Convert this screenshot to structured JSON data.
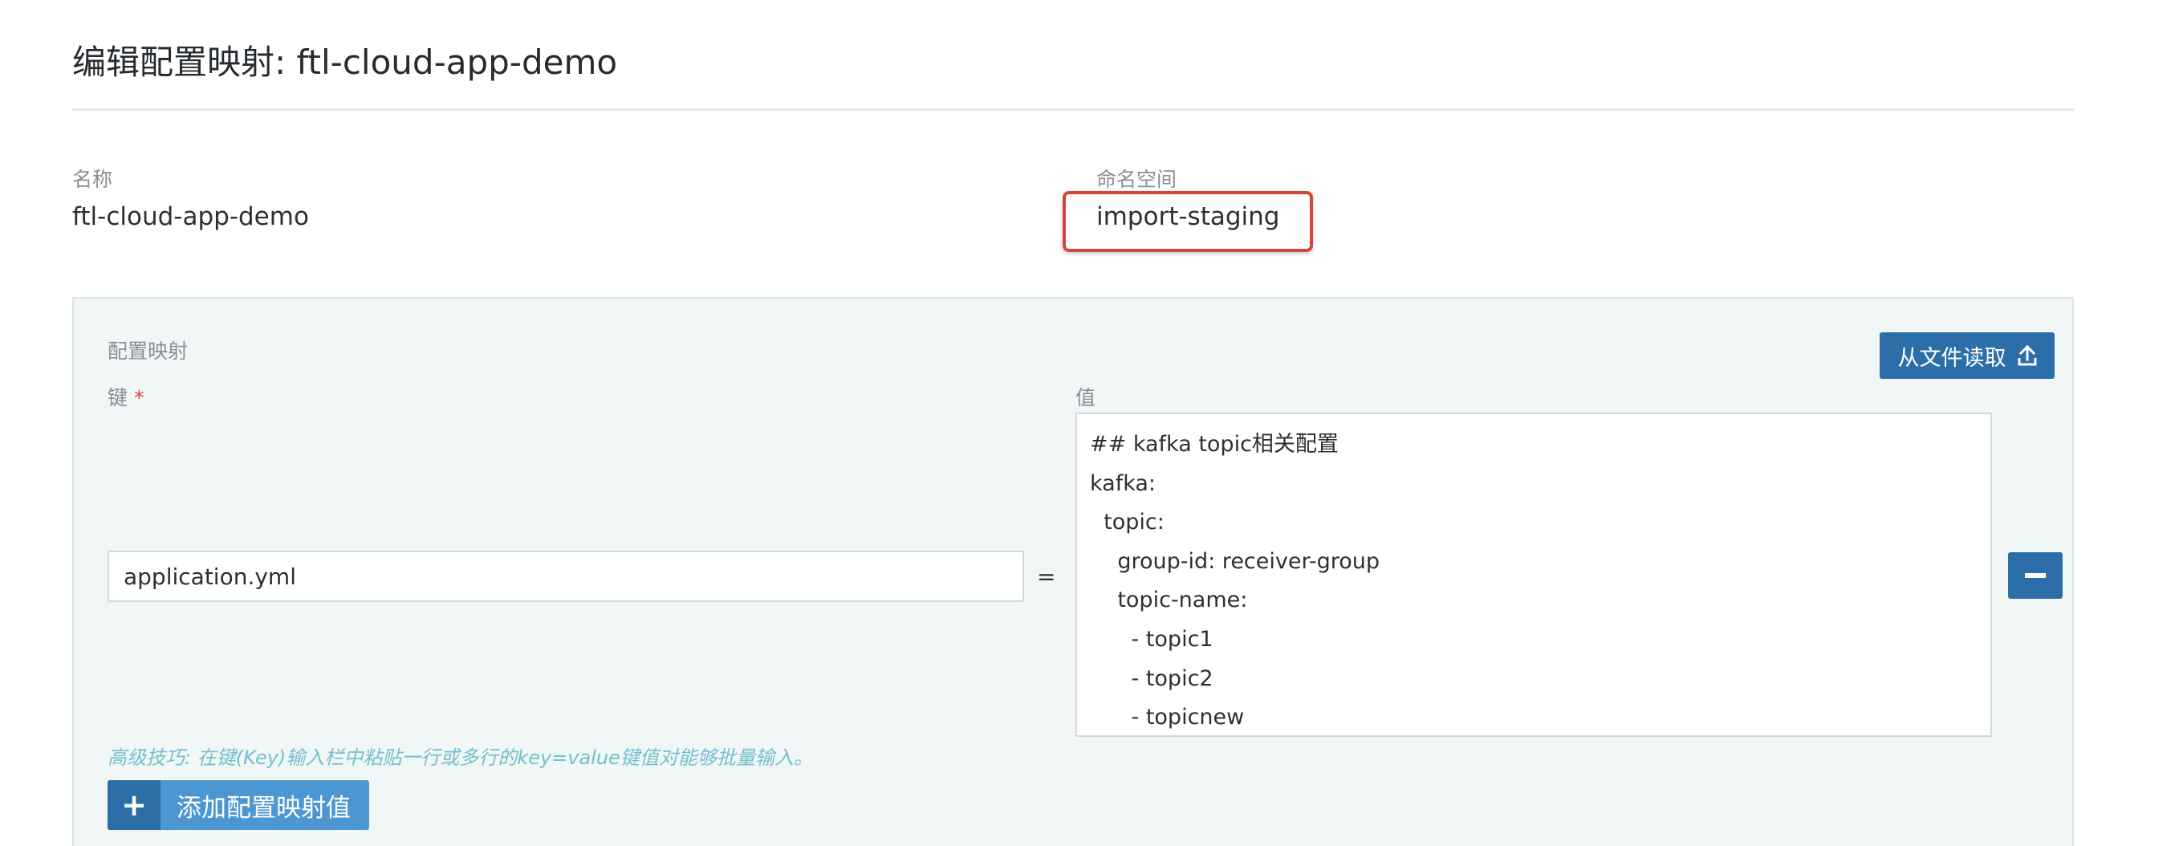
{
  "header": {
    "title": "编辑配置映射: ftl-cloud-app-demo"
  },
  "fields": {
    "name_label": "名称",
    "name_value": "ftl-cloud-app-demo",
    "namespace_label": "命名空间",
    "namespace_value": "import-staging"
  },
  "highlight": {
    "color": "#d6453a"
  },
  "configmap": {
    "section_label": "配置映射",
    "key_label": "键",
    "required_mark": "*",
    "value_label": "值",
    "read_from_file_label": "从文件读取",
    "key_input_value": "application.yml",
    "equals": "=",
    "value_lines": [
      "## kafka topic相关配置",
      "kafka:",
      "  topic:",
      "    group-id: receiver-group",
      "    topic-name:",
      "      - topic1",
      "      - topic2",
      "      - topicnew"
    ],
    "tip": "高级技巧: 在键(Key)输入栏中粘贴一行或多行的key=value键值对能够批量输入。",
    "add_button_label": "添加配置映射值"
  },
  "icons": {
    "upload": "upload-icon",
    "remove": "minus-icon",
    "add": "plus-icon"
  },
  "colors": {
    "primary_button": "#2c6fa8",
    "add_button": "#4c97d2",
    "tip_text": "#74c0ce",
    "panel_bg": "#f1f6f7"
  }
}
